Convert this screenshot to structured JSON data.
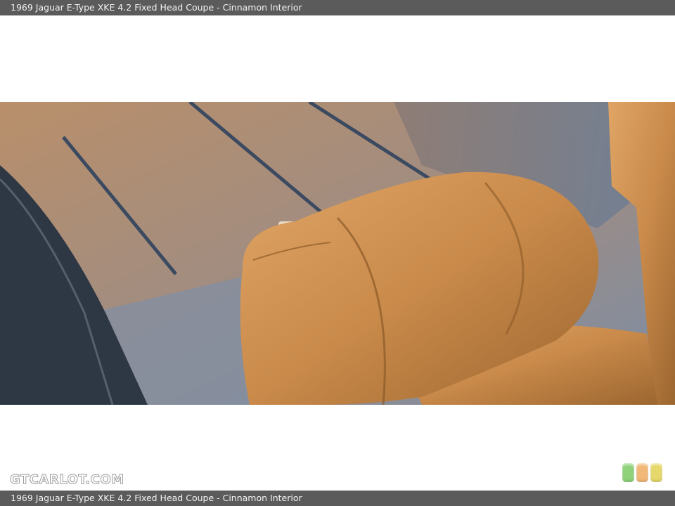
{
  "header": {
    "title": "1969 Jaguar E-Type XKE 4.2 Fixed Head Coupe - Cinnamon Interior"
  },
  "footer": {
    "caption": "1969 Jaguar E-Type XKE 4.2 Fixed Head Coupe - Cinnamon Interior"
  },
  "watermark": {
    "text": "GTCARLOT.COM"
  },
  "photo": {
    "subject": "cinnamon-leather-headrest-and-rear-floor"
  },
  "colors": {
    "bar_bg": "#5b5b5b",
    "leather": "#c98a4a",
    "swatches": [
      "#8fd27a",
      "#f2b877",
      "#e6d86a"
    ]
  },
  "swatch_icons": [
    "green-swatch-icon",
    "orange-swatch-icon",
    "yellow-swatch-icon"
  ]
}
